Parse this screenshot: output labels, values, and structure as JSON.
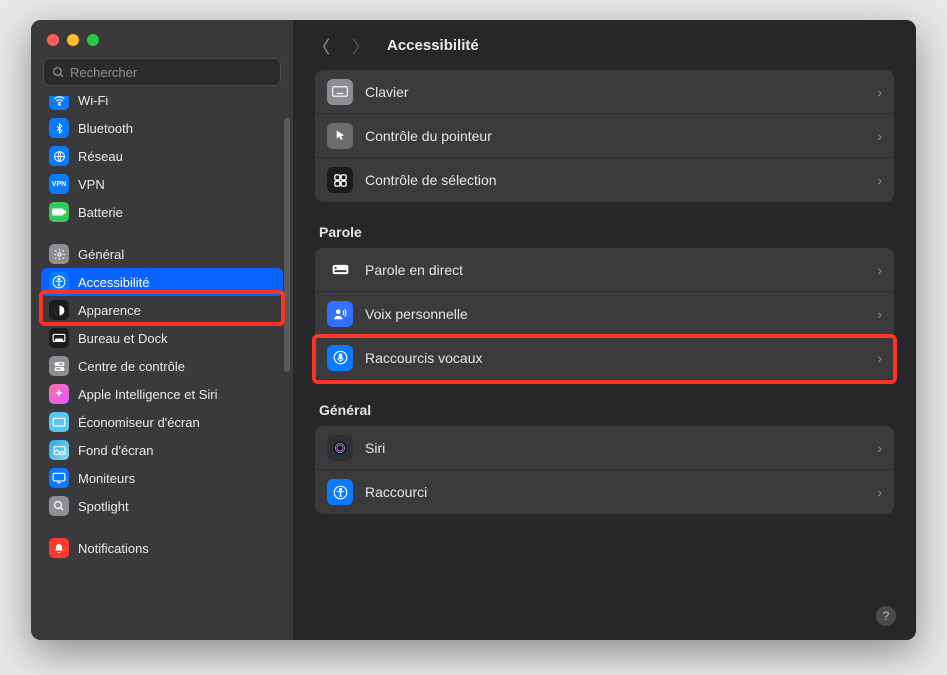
{
  "search": {
    "placeholder": "Rechercher"
  },
  "sidebar": {
    "items": [
      {
        "label": "Wi-Fi",
        "bg": "#0a7aff",
        "glyph": "wifi"
      },
      {
        "label": "Bluetooth",
        "bg": "#0a7aff",
        "glyph": "bt"
      },
      {
        "label": "Réseau",
        "bg": "#0a7aff",
        "glyph": "globe"
      },
      {
        "label": "VPN",
        "bg": "#0a7aff",
        "glyph": "vpn"
      },
      {
        "label": "Batterie",
        "bg": "#34c759",
        "glyph": "battery"
      }
    ],
    "items2": [
      {
        "label": "Général",
        "bg": "#8e8e93",
        "glyph": "gear"
      },
      {
        "label": "Accessibilité",
        "bg": "#0a7aff",
        "glyph": "access",
        "selected": true
      },
      {
        "label": "Apparence",
        "bg": "#1c1c1e",
        "glyph": "appearance"
      },
      {
        "label": "Bureau et Dock",
        "bg": "#1c1c1e",
        "glyph": "dock"
      },
      {
        "label": "Centre de contrôle",
        "bg": "#8e8e93",
        "glyph": "cc"
      },
      {
        "label": "Apple Intelligence et Siri",
        "bg": "#ff2e86",
        "glyph": "ai"
      },
      {
        "label": "Économiseur d'écran",
        "bg": "#56c8ef",
        "glyph": "saver"
      },
      {
        "label": "Fond d'écran",
        "bg": "#2aa7e0",
        "glyph": "wall"
      },
      {
        "label": "Moniteurs",
        "bg": "#0a7aff",
        "glyph": "display"
      },
      {
        "label": "Spotlight",
        "bg": "#8e8e93",
        "glyph": "search"
      }
    ],
    "items3": [
      {
        "label": "Notifications",
        "bg": "#ff3b30",
        "glyph": "bell"
      }
    ]
  },
  "main": {
    "title": "Accessibilité",
    "group0": [
      {
        "label": "Clavier",
        "bg": "#8e8e93",
        "glyph": "kb"
      },
      {
        "label": "Contrôle du pointeur",
        "bg": "#6d6d70",
        "glyph": "pointer"
      },
      {
        "label": "Contrôle de sélection",
        "bg": "#1c1c1e",
        "glyph": "switch"
      }
    ],
    "group1_title": "Parole",
    "group1": [
      {
        "label": "Parole en direct",
        "bg": "#3a3a3c",
        "glyph": "live"
      },
      {
        "label": "Voix personnelle",
        "bg": "#3470ff",
        "glyph": "voice"
      },
      {
        "label": "Raccourcis vocaux",
        "bg": "#0a7aff",
        "glyph": "mic",
        "highlight": true
      }
    ],
    "group2_title": "Général",
    "group2": [
      {
        "label": "Siri",
        "bg": "#303034",
        "glyph": "siri"
      },
      {
        "label": "Raccourci",
        "bg": "#0a7aff",
        "glyph": "shortcut"
      }
    ]
  },
  "help": "?"
}
